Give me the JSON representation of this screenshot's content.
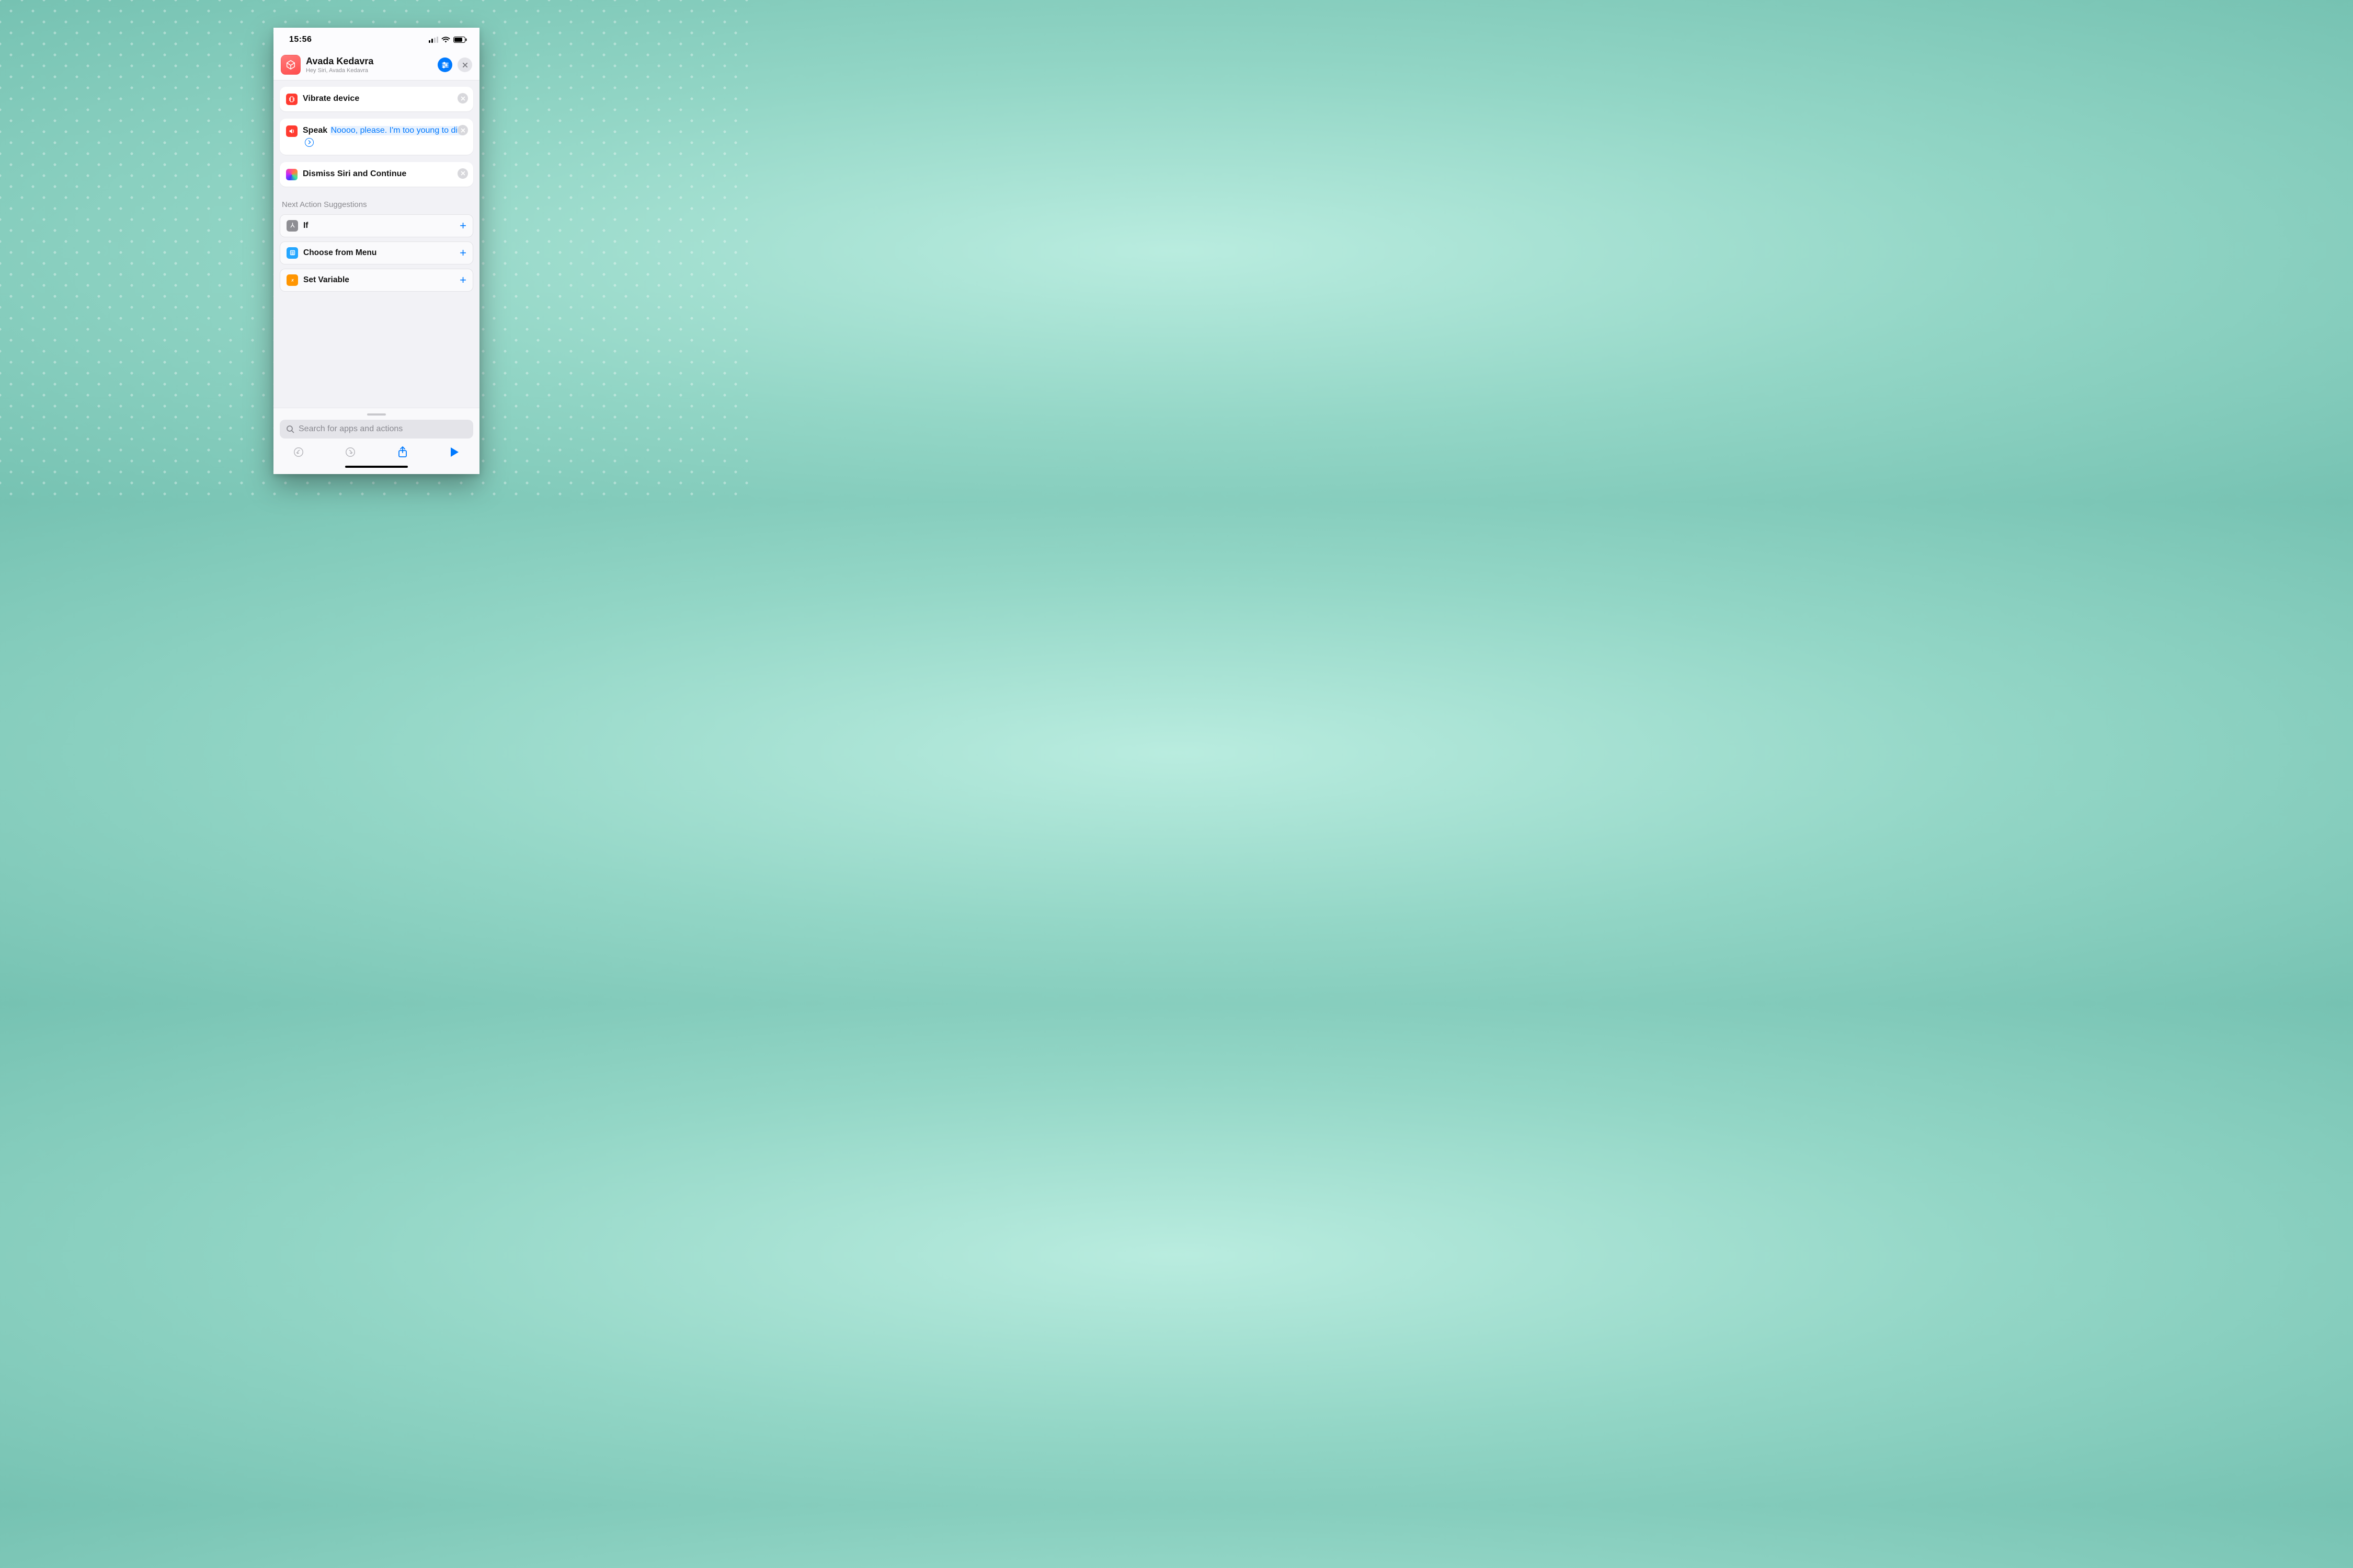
{
  "status": {
    "time": "15:56"
  },
  "header": {
    "title": "Avada Kedavra",
    "subtitle": "Hey Siri, Avada Kedavra"
  },
  "actions": {
    "vibrate": {
      "title": "Vibrate device"
    },
    "speak": {
      "title": "Speak",
      "text": "Noooo, please. I'm too young to die."
    },
    "dismiss": {
      "title": "Dismiss Siri and Continue"
    }
  },
  "suggestions": {
    "heading": "Next Action Suggestions",
    "items": [
      {
        "label": "If"
      },
      {
        "label": "Choose from Menu"
      },
      {
        "label": "Set Variable"
      }
    ]
  },
  "search": {
    "placeholder": "Search for apps and actions"
  }
}
